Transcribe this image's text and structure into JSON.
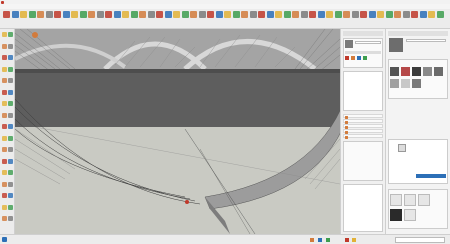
{
  "window": {
    "title": ""
  },
  "menubar": {
    "items": []
  },
  "status": {
    "message": ""
  },
  "colors": {
    "sky": "#a7a7a7",
    "deck": "#5e5e5e",
    "ground": "#c9cac3",
    "accent_orange": "#d27b3c",
    "toolbar_bg": "#ececec",
    "panel_bg": "#f3f3f3",
    "red": "#c0392b",
    "blue": "#2c6fb7",
    "yellow": "#e2b136",
    "green": "#3d9e4f"
  },
  "icons": {
    "toolbar": [
      "select-icon",
      "eraser-icon",
      "paint-bucket-icon",
      "pencil-icon",
      "arc-icon",
      "rectangle-icon",
      "circle-icon",
      "polygon-icon",
      "push-pull-icon",
      "move-icon",
      "rotate-icon",
      "scale-icon",
      "follow-me-icon",
      "offset-icon",
      "tape-measure-icon",
      "dimension-icon",
      "protractor-icon",
      "text-icon",
      "axes-icon",
      "3d-text-icon",
      "orbit-icon",
      "pan-icon",
      "zoom-icon",
      "zoom-window-icon",
      "zoom-extents-icon",
      "previous-view-icon",
      "next-view-icon",
      "iso-view-icon",
      "top-view-icon",
      "front-view-icon",
      "right-view-icon",
      "back-view-icon",
      "left-view-icon",
      "xray-icon",
      "wireframe-icon",
      "hidden-line-icon",
      "shaded-icon",
      "textured-icon",
      "monochrome-icon",
      "section-plane-icon",
      "warehouse-icon",
      "extension-icon",
      "layer-icon",
      "camera-icon",
      "walk-icon",
      "look-around-icon",
      "position-camera-icon",
      "sandbox-icon",
      "solid-tools-icon",
      "render-icon",
      "light-icon",
      "settings-icon"
    ],
    "left_tools": [
      "select-icon",
      "component-icon",
      "paint-icon",
      "eraser-icon",
      "line-icon",
      "freehand-icon",
      "rectangle-icon",
      "rotated-rectangle-icon",
      "circle-icon",
      "polygon-icon",
      "arc-icon",
      "pie-icon",
      "move-icon",
      "push-pull-icon",
      "rotate-icon",
      "follow-me-icon",
      "scale-icon",
      "offset-icon",
      "tape-icon",
      "dimension-icon",
      "protractor-icon",
      "text-icon",
      "axes-icon",
      "orbit-icon",
      "pan-icon",
      "zoom-icon",
      "zoom-extents-icon",
      "walk-icon",
      "look-around-icon",
      "section-icon",
      "position-camera-icon",
      "warehouse-icon",
      "extension-icon",
      "ruby-icon"
    ]
  }
}
